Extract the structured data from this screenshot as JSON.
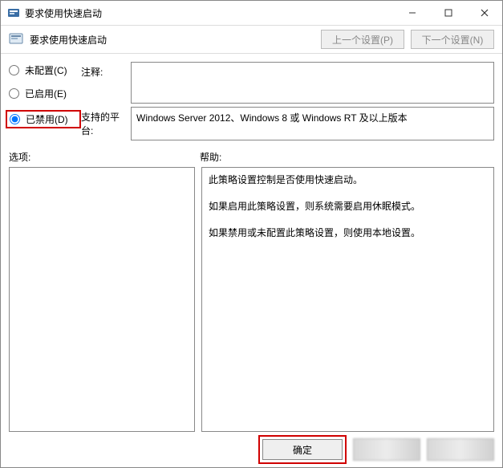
{
  "window": {
    "title": "要求使用快速启动"
  },
  "subheader": {
    "title": "要求使用快速启动",
    "prev_btn": "上一个设置(P)",
    "next_btn": "下一个设置(N)"
  },
  "radios": {
    "not_configured": "未配置(C)",
    "enabled": "已启用(E)",
    "disabled": "已禁用(D)",
    "selected": "disabled"
  },
  "fields": {
    "comment_label": "注释:",
    "comment_value": "",
    "supported_label": "支持的平台:",
    "supported_value": "Windows Server 2012、Windows 8 或 Windows RT 及以上版本"
  },
  "labels": {
    "options": "选项:",
    "help": "帮助:"
  },
  "help": {
    "p1": "此策略设置控制是否使用快速启动。",
    "p2": "如果启用此策略设置，则系统需要启用休眠模式。",
    "p3": "如果禁用或未配置此策略设置，则使用本地设置。"
  },
  "footer": {
    "ok": "确定"
  }
}
